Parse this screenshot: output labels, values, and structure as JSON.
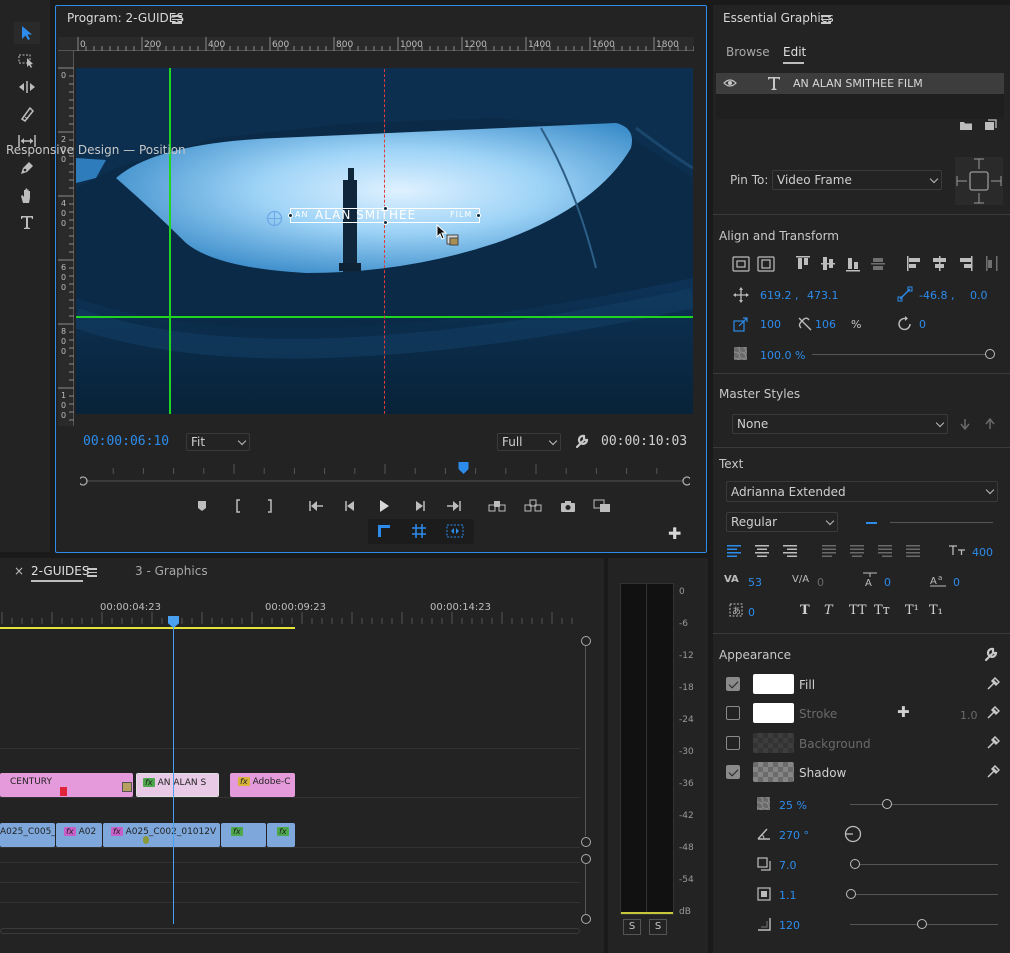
{
  "program": {
    "title": "Program: 2-GUIDES",
    "ruler_h_labels": [
      "0",
      "200",
      "400",
      "600",
      "800",
      "1000",
      "1200",
      "1400",
      "1600",
      "1800"
    ],
    "ruler_v_labels": [
      "0",
      "2\n0\n0",
      "4\n0\n0",
      "6\n0\n0",
      "8\n0\n0",
      "1\n0\n0"
    ],
    "title_text_left": "AN",
    "title_text_main": "ALAN SMITHEE",
    "title_text_right": "FILM",
    "current_time": "00:00:06:10",
    "zoom": "Fit",
    "resolution": "Full",
    "duration": "00:00:10:03",
    "playhead_fraction": 0.63
  },
  "tools": [
    "selection-tool",
    "track-select-tool",
    "ripple-edit-tool",
    "razor-tool",
    "slip-tool",
    "pen-tool",
    "hand-tool",
    "type-tool"
  ],
  "timeline": {
    "tabs": [
      {
        "label": "2-GUIDES",
        "active": true
      },
      {
        "label": "3 - Graphics",
        "active": false
      }
    ],
    "timecodes": [
      "00:00:04:23",
      "00:00:09:23",
      "00:00:14:23"
    ],
    "clips_v2": [
      {
        "label": "CENTURY",
        "color": "#e59bdb"
      },
      {
        "label": "AN ALAN S",
        "color": "#e8c9e6"
      },
      {
        "label": "Adobe-C",
        "color": "#e59bdb"
      }
    ],
    "clips_v1": [
      {
        "label": "A025_C005_01",
        "color": "#7ea8dc"
      },
      {
        "label": "A02",
        "color": "#7ea8dc"
      },
      {
        "label": "A025_C002_01012V",
        "color": "#7ea8dc"
      },
      {
        "label": "",
        "color": "#7ea8dc"
      },
      {
        "label": "",
        "color": "#7ea8dc"
      }
    ]
  },
  "meter": {
    "scale": [
      "0",
      "-6",
      "-12",
      "-18",
      "-24",
      "-30",
      "-36",
      "-42",
      "-48",
      "-54",
      "dB"
    ],
    "solo_left": "S",
    "solo_right": "S"
  },
  "eg": {
    "title": "Essential Graphics",
    "tab_browse": "Browse",
    "tab_edit": "Edit",
    "layer_name": "AN ALAN SMITHEE FILM",
    "responsive_title": "Responsive Design — Position",
    "pin_to_label": "Pin To:",
    "pin_to_value": "Video Frame",
    "align_title": "Align and Transform",
    "pos_x": "619.2 ,",
    "pos_y": "473.1",
    "anchor_x": "-46.8 ,",
    "anchor_y": "0.0",
    "scale": "100",
    "scale_h": "106",
    "scale_unit": "%",
    "rotation": "0",
    "opacity": "100.0 %",
    "opacity_fraction": 1.0,
    "master_styles_title": "Master Styles",
    "master_style_value": "None",
    "text_title": "Text",
    "font": "Adrianna Extended",
    "font_style": "Regular",
    "font_size": "400",
    "kerning": "53",
    "tracking": "0",
    "leading": "0",
    "baseline": "0",
    "tsume": "0",
    "type_styles": [
      "T",
      "T",
      "TT",
      "Tт",
      "T¹",
      "T₁"
    ],
    "appearance_title": "Appearance",
    "fill_label": "Fill",
    "stroke_label": "Stroke",
    "stroke_width": "1.0",
    "background_label": "Background",
    "shadow_label": "Shadow",
    "shadow_opacity": "25 %",
    "shadow_angle": "270 °",
    "shadow_distance": "7.0",
    "shadow_size": "1.1",
    "shadow_blur": "120",
    "colors": {
      "accent": "#2d8ceb",
      "guide": "#22d422",
      "fill": "#ffffff",
      "stroke": "#ffffff"
    }
  }
}
